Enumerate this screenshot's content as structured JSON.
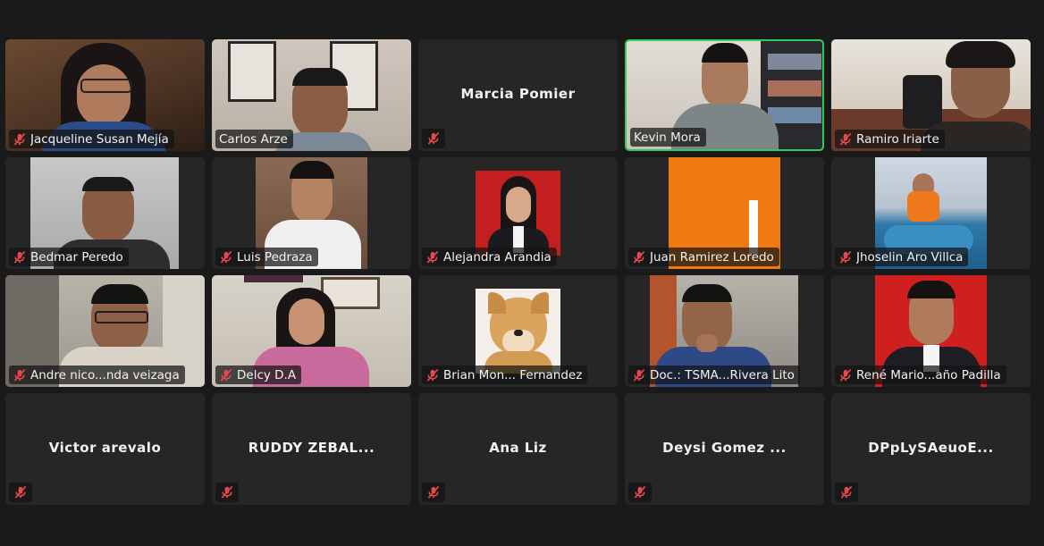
{
  "participants": [
    {
      "name": "Jacqueline Susan Mejía"
    },
    {
      "name": "Carlos Arze"
    },
    {
      "name": "Marcia Pomier"
    },
    {
      "name": "Kevin Mora",
      "active_speaker": true
    },
    {
      "name": "Ramiro Iriarte"
    },
    {
      "name": "Bedmar Peredo"
    },
    {
      "name": "Luis Pedraza"
    },
    {
      "name": "Alejandra Arandia"
    },
    {
      "name": "Juan Ramirez Loredo"
    },
    {
      "name": "Jhoselin Aro Villca"
    },
    {
      "name": "Andre nico...nda veizaga"
    },
    {
      "name": "Delcy D.A"
    },
    {
      "name": "Brian Mon... Fernandez"
    },
    {
      "name": "Doc.: TSMA...Rivera Lito"
    },
    {
      "name": "René Mario...año Padilla"
    },
    {
      "name": "Victor arevalo"
    },
    {
      "name": "RUDDY ZEBAL..."
    },
    {
      "name": "Ana Liz"
    },
    {
      "name": "Deysi Gomez ..."
    },
    {
      "name": "DPpLySAeuoE..."
    }
  ],
  "colors": {
    "background": "#1a1a1a",
    "tile": "#262626",
    "active_border": "#2ecc5a",
    "muted_icon": "#e5484d"
  },
  "icons": {
    "muted": "mic-muted-icon"
  }
}
